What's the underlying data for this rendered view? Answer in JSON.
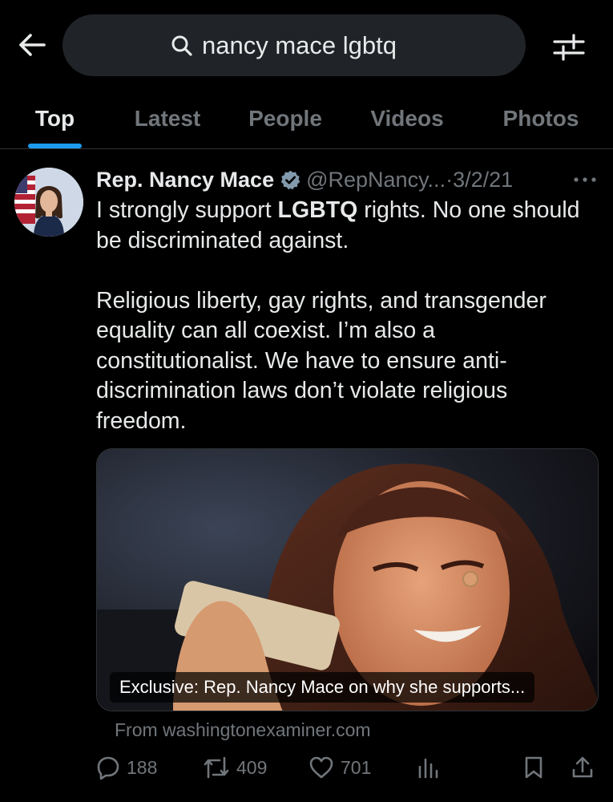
{
  "search": {
    "query": "nancy mace lgbtq",
    "back_icon": "arrow-left-icon",
    "search_icon": "magnifier-icon",
    "filter_icon": "sliders-icon"
  },
  "tabs": [
    {
      "label": "Top",
      "active": true
    },
    {
      "label": "Latest",
      "active": false
    },
    {
      "label": "People",
      "active": false
    },
    {
      "label": "Videos",
      "active": false
    },
    {
      "label": "Photos",
      "active": false
    }
  ],
  "tweet": {
    "display_name": "Rep. Nancy Mace",
    "handle": "@RepNancy...",
    "separator": "·",
    "date": "3/2/21",
    "text_p1_before": "I strongly support ",
    "text_p1_bold": "LGBTQ",
    "text_p1_after": " rights. No one should be discriminated against.",
    "text_p2": "Religious liberty, gay rights, and transgender equality can all coexist. I’m also a constitutionalist. We have to ensure anti-discrimination laws don’t violate religious freedom.",
    "card_caption": "Exclusive: Rep. Nancy Mace on why she supports...",
    "card_source": "From washingtonexaminer.com",
    "replies": "188",
    "retweets": "409",
    "likes": "701"
  },
  "colors": {
    "background": "#000000",
    "accent": "#1d9bf0",
    "muted": "#71767b",
    "text": "#e7e9ea"
  }
}
